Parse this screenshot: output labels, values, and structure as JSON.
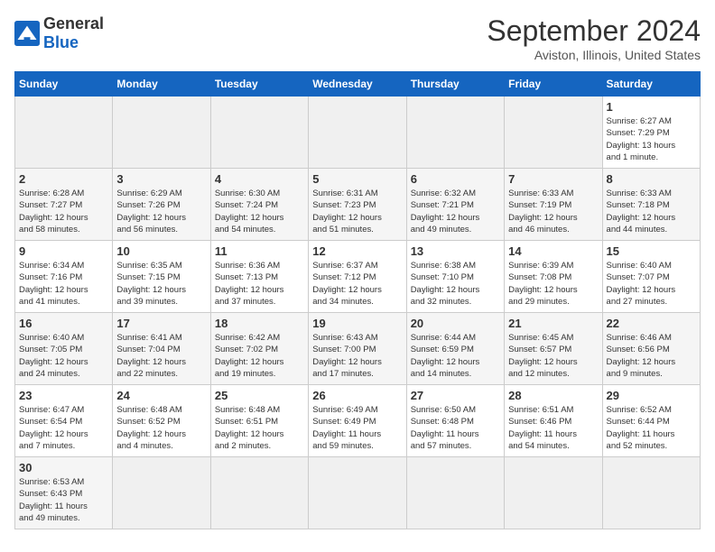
{
  "logo": {
    "text_general": "General",
    "text_blue": "Blue"
  },
  "header": {
    "month_year": "September 2024",
    "location": "Aviston, Illinois, United States"
  },
  "weekdays": [
    "Sunday",
    "Monday",
    "Tuesday",
    "Wednesday",
    "Thursday",
    "Friday",
    "Saturday"
  ],
  "days": [
    {
      "num": "",
      "info": ""
    },
    {
      "num": "",
      "info": ""
    },
    {
      "num": "",
      "info": ""
    },
    {
      "num": "",
      "info": ""
    },
    {
      "num": "",
      "info": ""
    },
    {
      "num": "",
      "info": ""
    },
    {
      "num": "1",
      "info": "Sunrise: 6:27 AM\nSunset: 7:29 PM\nDaylight: 13 hours\nand 1 minute."
    },
    {
      "num": "2",
      "info": "Sunrise: 6:28 AM\nSunset: 7:27 PM\nDaylight: 12 hours\nand 58 minutes."
    },
    {
      "num": "3",
      "info": "Sunrise: 6:29 AM\nSunset: 7:26 PM\nDaylight: 12 hours\nand 56 minutes."
    },
    {
      "num": "4",
      "info": "Sunrise: 6:30 AM\nSunset: 7:24 PM\nDaylight: 12 hours\nand 54 minutes."
    },
    {
      "num": "5",
      "info": "Sunrise: 6:31 AM\nSunset: 7:23 PM\nDaylight: 12 hours\nand 51 minutes."
    },
    {
      "num": "6",
      "info": "Sunrise: 6:32 AM\nSunset: 7:21 PM\nDaylight: 12 hours\nand 49 minutes."
    },
    {
      "num": "7",
      "info": "Sunrise: 6:33 AM\nSunset: 7:19 PM\nDaylight: 12 hours\nand 46 minutes."
    },
    {
      "num": "8",
      "info": "Sunrise: 6:33 AM\nSunset: 7:18 PM\nDaylight: 12 hours\nand 44 minutes."
    },
    {
      "num": "9",
      "info": "Sunrise: 6:34 AM\nSunset: 7:16 PM\nDaylight: 12 hours\nand 41 minutes."
    },
    {
      "num": "10",
      "info": "Sunrise: 6:35 AM\nSunset: 7:15 PM\nDaylight: 12 hours\nand 39 minutes."
    },
    {
      "num": "11",
      "info": "Sunrise: 6:36 AM\nSunset: 7:13 PM\nDaylight: 12 hours\nand 37 minutes."
    },
    {
      "num": "12",
      "info": "Sunrise: 6:37 AM\nSunset: 7:12 PM\nDaylight: 12 hours\nand 34 minutes."
    },
    {
      "num": "13",
      "info": "Sunrise: 6:38 AM\nSunset: 7:10 PM\nDaylight: 12 hours\nand 32 minutes."
    },
    {
      "num": "14",
      "info": "Sunrise: 6:39 AM\nSunset: 7:08 PM\nDaylight: 12 hours\nand 29 minutes."
    },
    {
      "num": "15",
      "info": "Sunrise: 6:40 AM\nSunset: 7:07 PM\nDaylight: 12 hours\nand 27 minutes."
    },
    {
      "num": "16",
      "info": "Sunrise: 6:40 AM\nSunset: 7:05 PM\nDaylight: 12 hours\nand 24 minutes."
    },
    {
      "num": "17",
      "info": "Sunrise: 6:41 AM\nSunset: 7:04 PM\nDaylight: 12 hours\nand 22 minutes."
    },
    {
      "num": "18",
      "info": "Sunrise: 6:42 AM\nSunset: 7:02 PM\nDaylight: 12 hours\nand 19 minutes."
    },
    {
      "num": "19",
      "info": "Sunrise: 6:43 AM\nSunset: 7:00 PM\nDaylight: 12 hours\nand 17 minutes."
    },
    {
      "num": "20",
      "info": "Sunrise: 6:44 AM\nSunset: 6:59 PM\nDaylight: 12 hours\nand 14 minutes."
    },
    {
      "num": "21",
      "info": "Sunrise: 6:45 AM\nSunset: 6:57 PM\nDaylight: 12 hours\nand 12 minutes."
    },
    {
      "num": "22",
      "info": "Sunrise: 6:46 AM\nSunset: 6:56 PM\nDaylight: 12 hours\nand 9 minutes."
    },
    {
      "num": "23",
      "info": "Sunrise: 6:47 AM\nSunset: 6:54 PM\nDaylight: 12 hours\nand 7 minutes."
    },
    {
      "num": "24",
      "info": "Sunrise: 6:48 AM\nSunset: 6:52 PM\nDaylight: 12 hours\nand 4 minutes."
    },
    {
      "num": "25",
      "info": "Sunrise: 6:48 AM\nSunset: 6:51 PM\nDaylight: 12 hours\nand 2 minutes."
    },
    {
      "num": "26",
      "info": "Sunrise: 6:49 AM\nSunset: 6:49 PM\nDaylight: 11 hours\nand 59 minutes."
    },
    {
      "num": "27",
      "info": "Sunrise: 6:50 AM\nSunset: 6:48 PM\nDaylight: 11 hours\nand 57 minutes."
    },
    {
      "num": "28",
      "info": "Sunrise: 6:51 AM\nSunset: 6:46 PM\nDaylight: 11 hours\nand 54 minutes."
    },
    {
      "num": "29",
      "info": "Sunrise: 6:52 AM\nSunset: 6:44 PM\nDaylight: 11 hours\nand 52 minutes."
    },
    {
      "num": "30",
      "info": "Sunrise: 6:53 AM\nSunset: 6:43 PM\nDaylight: 11 hours\nand 49 minutes."
    },
    {
      "num": "",
      "info": ""
    },
    {
      "num": "",
      "info": ""
    },
    {
      "num": "",
      "info": ""
    },
    {
      "num": "",
      "info": ""
    },
    {
      "num": "",
      "info": ""
    }
  ]
}
